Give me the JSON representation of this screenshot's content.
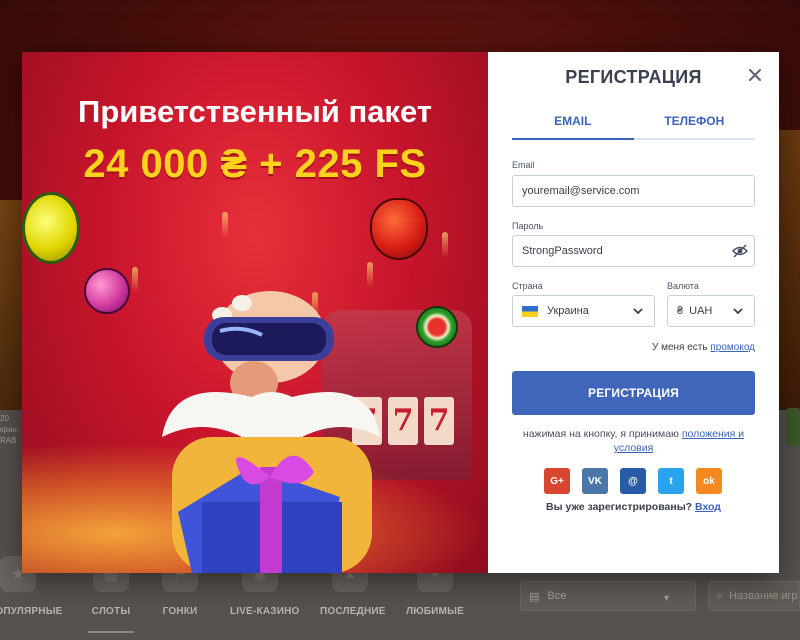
{
  "promo": {
    "title": "Приветственный пакет",
    "amount": "24 000 ₴ + 225 FS"
  },
  "registration": {
    "title": "РЕГИСТРАЦИЯ",
    "tabs": [
      {
        "label": "EMAIL",
        "active": true
      },
      {
        "label": "ТЕЛЕФОН",
        "active": false
      }
    ],
    "email": {
      "label": "Email",
      "value": "youremail@service.com"
    },
    "password": {
      "label": "Пароль",
      "value": "StrongPassword"
    },
    "country": {
      "label": "Страна",
      "value": "Украина"
    },
    "currency": {
      "label": "Валюта",
      "symbol": "₴",
      "value": "UAH"
    },
    "promocode": {
      "prefix": "У меня есть",
      "link": "промокод"
    },
    "submit_label": "РЕГИСТРАЦИЯ",
    "terms": {
      "prefix": "нажимая на кнопку, я принимаю",
      "link": "положения и условия"
    },
    "socials": [
      {
        "name": "google-plus",
        "glyph": "G+",
        "color": "#d8462f"
      },
      {
        "name": "vk",
        "glyph": "VK",
        "color": "#4a76a8"
      },
      {
        "name": "mail-ru",
        "glyph": "@",
        "color": "#2a5ba8"
      },
      {
        "name": "twitter",
        "glyph": "t",
        "color": "#2aa3ef"
      },
      {
        "name": "odnoklassniki",
        "glyph": "ok",
        "color": "#f5891f"
      }
    ],
    "login": {
      "prefix": "Вы уже зарегистрированы?",
      "link": "Вход"
    }
  },
  "background": {
    "categories": [
      {
        "label": "ПОПУЛЯРНЫЕ",
        "icon": "star-icon"
      },
      {
        "label": "СЛОТЫ",
        "icon": "slots-icon"
      },
      {
        "label": "ГОНКИ",
        "icon": "flag-icon"
      },
      {
        "label": "LIVE-КАЗИНО",
        "icon": "chip-icon"
      },
      {
        "label": "ПОСЛЕДНИЕ",
        "icon": "hourglass-icon"
      },
      {
        "label": "ЛЮБИМЫЕ",
        "icon": "heart-icon"
      }
    ],
    "filter_value": "Все",
    "search_placeholder": "Название игр",
    "side_text": "20 кран. RAB"
  },
  "colors": {
    "accent": "#3f66b9",
    "promo_red": "#c8152c",
    "promo_yellow": "#ffd21e"
  }
}
